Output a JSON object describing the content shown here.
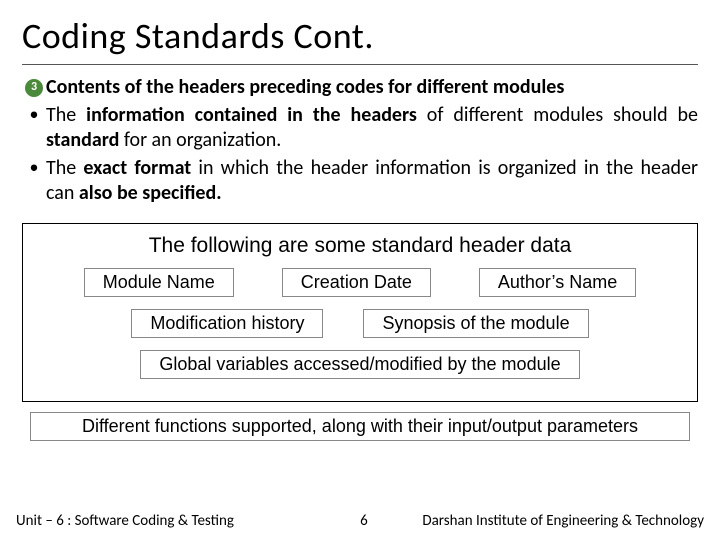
{
  "title": "Coding Standards Cont.",
  "badge_number": "3",
  "bullets": {
    "b0": "Contents of the headers preceding codes for different modules",
    "b1_pre": "The ",
    "b1_bold1": "information contained in the headers",
    "b1_mid": " of different modules should be ",
    "b1_bold2": "standard",
    "b1_post": " for an organization.",
    "b2_pre": "The ",
    "b2_bold1": "exact format",
    "b2_mid": " in which the header information is organized in the header can ",
    "b2_bold2": "also be specified.",
    "b2_post": ""
  },
  "boxes": {
    "caption": "The following are some standard header data",
    "row1": {
      "c0": "Module Name",
      "c1": "Creation Date",
      "c2": "Author’s Name"
    },
    "row2": {
      "c0": "Modification history",
      "c1": "Synopsis of the module"
    },
    "row3": "Global variables accessed/modified by the module",
    "row4": "Different functions supported, along with their input/output parameters"
  },
  "footer": {
    "unit": "Unit – 6 : Software Coding & Testing",
    "page": "6",
    "institute": "Darshan Institute of Engineering & Technology"
  }
}
